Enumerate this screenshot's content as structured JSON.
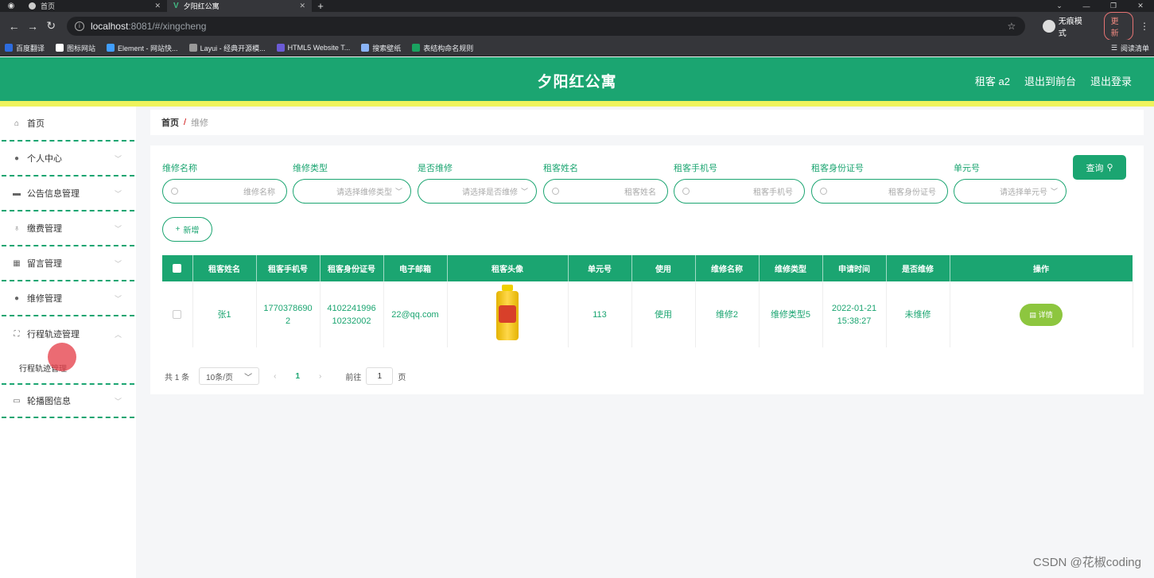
{
  "browser": {
    "tabs": [
      {
        "title": "首页",
        "active": false
      },
      {
        "title": "夕阳红公寓",
        "active": true
      }
    ],
    "url_host": "localhost",
    "url_path": ":8081/#/xingcheng",
    "incognito_label": "无痕模式",
    "update_label": "更新",
    "bookmarks": [
      "百度翻译",
      "图标网站",
      "Element - 网站快...",
      "Layui - 经典开源模...",
      "HTML5 Website T...",
      "搜索壁纸",
      "表结构命名规则"
    ],
    "reading_list": "阅读清单"
  },
  "header": {
    "title": "夕阳红公寓",
    "user": "租客 a2",
    "back_front": "退出到前台",
    "logout": "退出登录"
  },
  "sidebar": {
    "items": [
      {
        "label": "首页",
        "icon": "home-icon"
      },
      {
        "label": "个人中心",
        "icon": "user-icon"
      },
      {
        "label": "公告信息管理",
        "icon": "message-icon"
      },
      {
        "label": "缴费管理",
        "icon": "microphone-icon"
      },
      {
        "label": "留言管理",
        "icon": "grid-icon"
      },
      {
        "label": "维修管理",
        "icon": "user-icon"
      },
      {
        "label": "行程轨迹管理",
        "icon": "frame-icon"
      },
      {
        "label": "轮播图信息",
        "icon": "chat-icon"
      }
    ],
    "sub_item": "行程轨迹管理"
  },
  "breadcrumb": {
    "home": "首页",
    "sep": "/",
    "current": "维修"
  },
  "filters": {
    "repair_name": {
      "label": "维修名称",
      "placeholder": "维修名称"
    },
    "repair_type": {
      "label": "维修类型",
      "placeholder": "请选择维修类型"
    },
    "is_repaired": {
      "label": "是否维修",
      "placeholder": "请选择是否维修"
    },
    "tenant_name": {
      "label": "租客姓名",
      "placeholder": "租客姓名"
    },
    "tenant_phone": {
      "label": "租客手机号",
      "placeholder": "租客手机号"
    },
    "tenant_id": {
      "label": "租客身份证号",
      "placeholder": "租客身份证号"
    },
    "unit_no": {
      "label": "单元号",
      "placeholder": "请选择单元号"
    },
    "query_label": "查询",
    "add_label": "新增"
  },
  "table": {
    "columns": [
      "租客姓名",
      "租客手机号",
      "租客身份证号",
      "电子邮箱",
      "租客头像",
      "单元号",
      "使用",
      "维修名称",
      "维修类型",
      "申请时间",
      "是否维修",
      "操作"
    ],
    "rows": [
      {
        "name": "张1",
        "phone_1": "1770378690",
        "phone_2": "2",
        "id_1": "4102241996",
        "id_2": "10232002",
        "email": "22@qq.com",
        "unit": "113",
        "usage": "使用",
        "repair_name": "维修2",
        "repair_type": "维修类型5",
        "date": "2022-01-21",
        "time": "15:38:27",
        "status": "未维修",
        "action": "详情"
      }
    ]
  },
  "pager": {
    "total": "共 1 条",
    "page_size": "10条/页",
    "current_page": "1",
    "goto": "前往",
    "goto_value": "1",
    "page_unit": "页"
  },
  "watermark": "CSDN @花椒coding",
  "colors": {
    "primary": "#1ba571",
    "accent_bar": "#eef35c",
    "detail_button": "#8dc63f"
  }
}
